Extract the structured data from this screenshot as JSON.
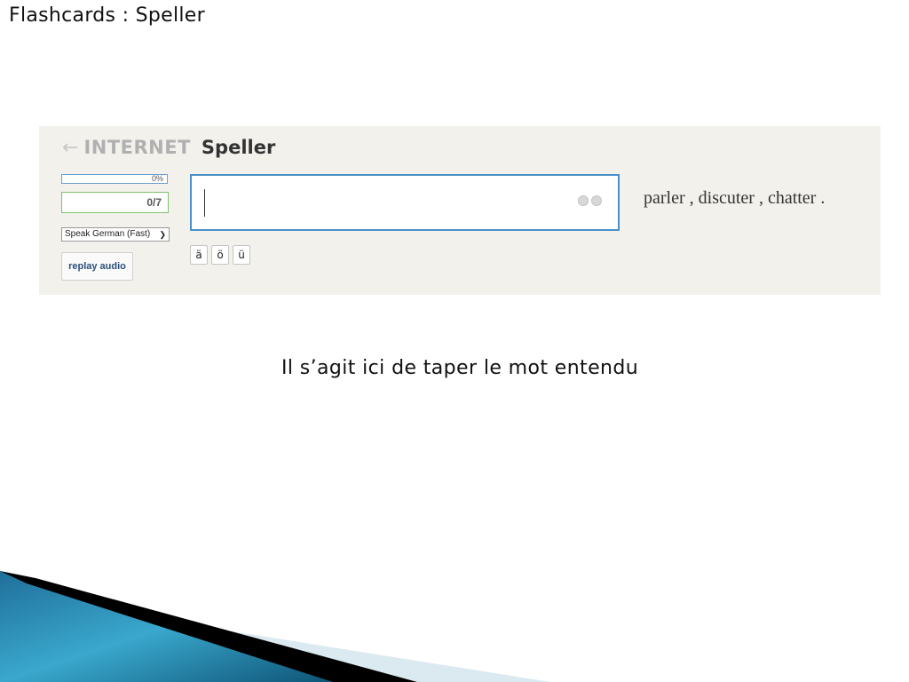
{
  "slide": {
    "title": "Flashcards : Speller",
    "caption": "Il s’agit ici de taper le mot entendu"
  },
  "app": {
    "breadcrumb_arrow": "←",
    "deck_name": "INTERNET",
    "mode_title": "Speller",
    "progress_percent_label": "0%",
    "progress_percent": 0,
    "count_label": "0/7",
    "voice_select": {
      "selected": "Speak German (Fast)"
    },
    "replay_button_label": "replay audio",
    "answer_input": {
      "value": ""
    },
    "umlaut_keys": [
      "ä",
      "ö",
      "ü"
    ],
    "definition": "parler , discuter , chatter ."
  },
  "colors": {
    "panel_bg": "#f3f1ec",
    "input_border": "#4a90c9",
    "count_border": "#7cc26a",
    "replay_text": "#2c4f7a"
  }
}
